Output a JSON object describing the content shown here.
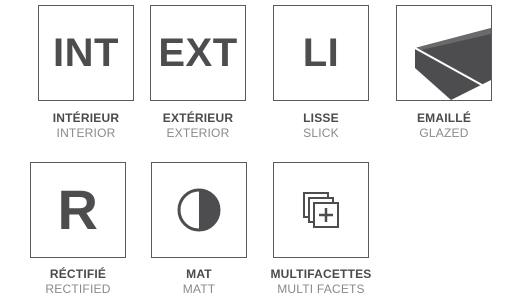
{
  "items": [
    {
      "glyph": "INT",
      "fr": "INTÉRIEUR",
      "en": "INTERIOR"
    },
    {
      "glyph": "EXT",
      "fr": "EXTÉRIEUR",
      "en": "EXTERIOR"
    },
    {
      "glyph": "LI",
      "fr": "LISSE",
      "en": "SLICK"
    },
    {
      "icon": "glazed-surface-icon",
      "fr": "EMAILLÉ",
      "en": "GLAZED"
    },
    {
      "glyph": "R",
      "fr": "RÉCTIFIÉ",
      "en": "RECTIFIED"
    },
    {
      "icon": "half-circle-matt-icon",
      "fr": "MAT",
      "en": "MATT"
    },
    {
      "icon": "stacked-squares-plus-icon",
      "fr": "MULTIFACETTES",
      "en": "MULTI FACETS"
    }
  ]
}
